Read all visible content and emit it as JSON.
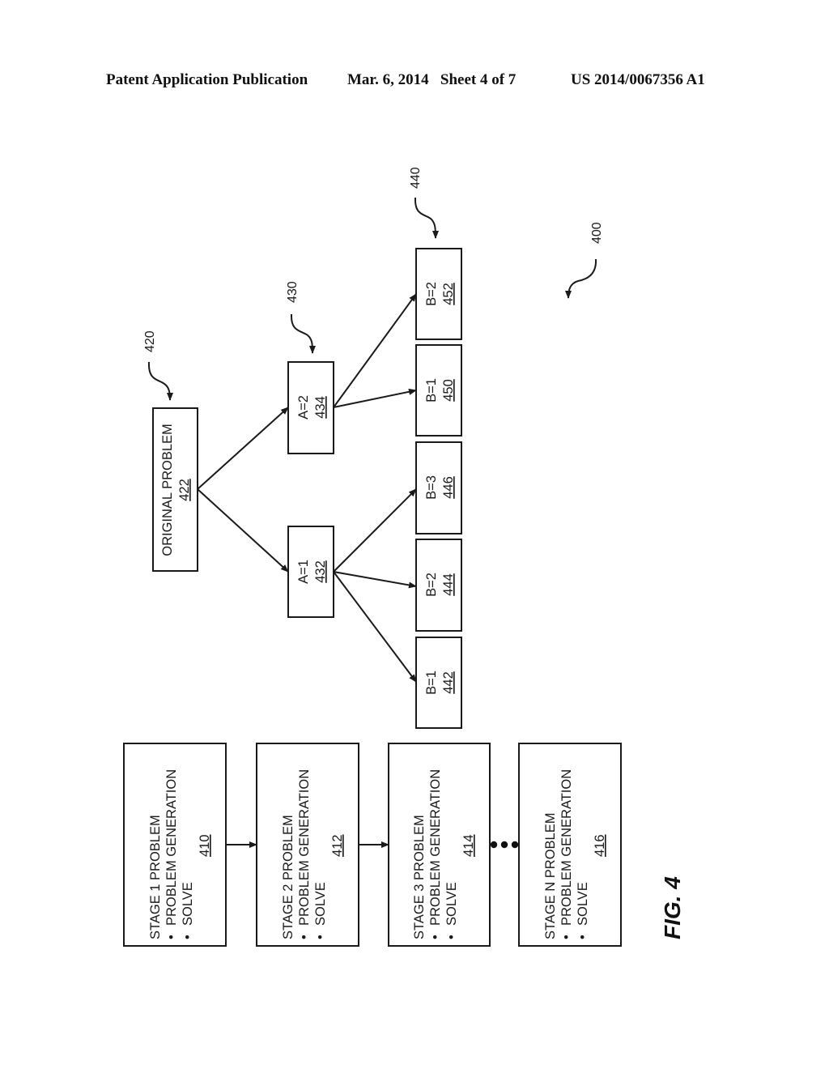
{
  "header": {
    "publication": "Patent Application Publication",
    "date_sheet": "Mar. 6, 2014   Sheet 4 of 7",
    "patent_number": "US 2014/0067356 A1"
  },
  "figure_label": "FIG. 4",
  "figure_ref": "400",
  "stages": [
    {
      "title": "STAGE 1 PROBLEM",
      "bullets": [
        "PROBLEM GENERATION",
        "SOLVE"
      ],
      "ref": "410"
    },
    {
      "title": "STAGE 2 PROBLEM",
      "bullets": [
        "PROBLEM GENERATION",
        "SOLVE"
      ],
      "ref": "412"
    },
    {
      "title": "STAGE 3 PROBLEM",
      "bullets": [
        "PROBLEM GENERATION",
        "SOLVE"
      ],
      "ref": "414"
    },
    {
      "title": "STAGE N PROBLEM",
      "bullets": [
        "PROBLEM GENERATION",
        "SOLVE"
      ],
      "ref": "416"
    }
  ],
  "bullet_glyph": "•",
  "tree": {
    "root": {
      "label": "ORIGINAL PROBLEM",
      "ref": "422",
      "callout": "420"
    },
    "level_a_callout": "430",
    "level_b_callout": "440",
    "level_a": [
      {
        "label": "A=1",
        "ref": "432"
      },
      {
        "label": "A=2",
        "ref": "434"
      }
    ],
    "level_b": [
      {
        "label": "B=1",
        "ref": "442",
        "parent": "432"
      },
      {
        "label": "B=2",
        "ref": "444",
        "parent": "432"
      },
      {
        "label": "B=3",
        "ref": "446",
        "parent": "432"
      },
      {
        "label": "B=1",
        "ref": "450",
        "parent": "434"
      },
      {
        "label": "B=2",
        "ref": "452",
        "parent": "434"
      }
    ]
  }
}
